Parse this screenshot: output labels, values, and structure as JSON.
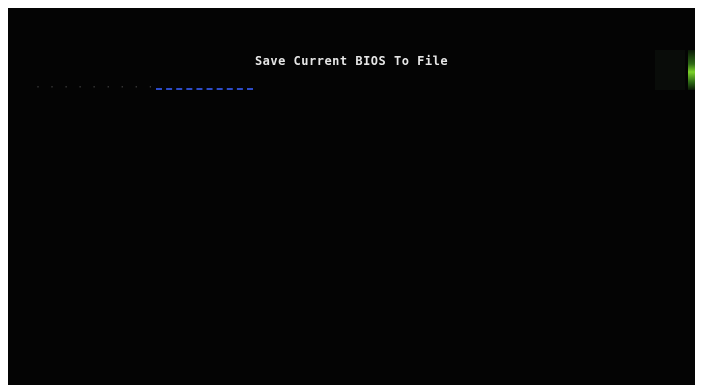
{
  "screen": {
    "title": "Save Current BIOS To File",
    "path_label": "",
    "path_value": ""
  },
  "colors": {
    "background": "#040404",
    "title_text": "#e6e6e6",
    "input_underline": "#2d4bc8",
    "side_indicator": "#7bd12a"
  }
}
